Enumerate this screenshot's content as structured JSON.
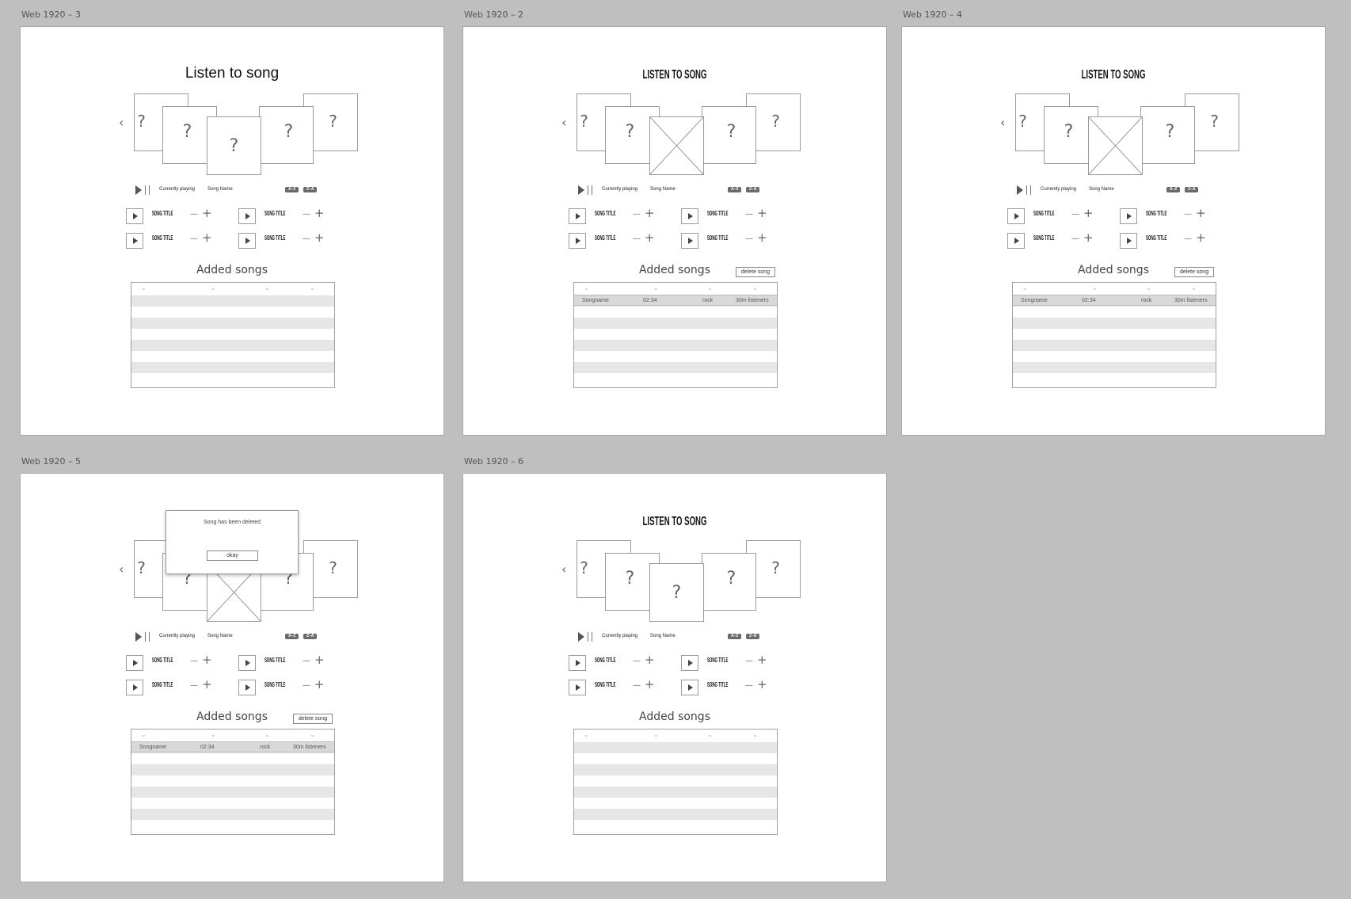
{
  "frames": [
    {
      "label": "Web 1920 – 3",
      "title": "Listen to song",
      "title_style": "regular",
      "center_card": "?",
      "prev_arrow": "‹",
      "next_arrow": "›",
      "card_marks": [
        "?",
        "?",
        "?",
        "?"
      ],
      "controls": {
        "currently_playing": "Currently playing",
        "song_name": "Song Name",
        "sort_az": "A–Z",
        "sort_za": "Z–A"
      },
      "songs": [
        "SONG TITLE",
        "SONG TITLE",
        "SONG TITLE",
        "SONG TITLE"
      ],
      "added_title": "Added songs",
      "delete_label": "",
      "row": null,
      "modal": null
    },
    {
      "label": "Web 1920 – 2",
      "title": "LISTEN TO SONG",
      "title_style": "condensed",
      "center_card": "image",
      "prev_arrow": "‹",
      "next_arrow": "›",
      "card_marks": [
        "?",
        "?",
        "?",
        "?"
      ],
      "controls": {
        "currently_playing": "Currently playing",
        "song_name": "Song Name",
        "sort_az": "A–Z",
        "sort_za": "Z–A"
      },
      "songs": [
        "SONG TITLE",
        "SONG TITLE",
        "SONG TITLE",
        "SONG TITLE"
      ],
      "added_title": "Added songs",
      "delete_label": "delete song",
      "row": {
        "name": "Songname",
        "duration": "02:34",
        "genre": "rock",
        "listeners": "30m listeners"
      },
      "modal": null
    },
    {
      "label": "Web 1920 – 4",
      "title": "LISTEN TO SONG",
      "title_style": "condensed",
      "center_card": "image",
      "prev_arrow": "‹",
      "next_arrow": "›",
      "card_marks": [
        "?",
        "?",
        "?",
        "?"
      ],
      "controls": {
        "currently_playing": "Currently playing",
        "song_name": "Song Name",
        "sort_az": "A–Z",
        "sort_za": "Z–A"
      },
      "songs": [
        "SONG TITLE",
        "SONG TITLE",
        "SONG TITLE",
        "SONG TITLE"
      ],
      "added_title": "Added songs",
      "delete_label": "delete song",
      "row": {
        "name": "Songname",
        "duration": "02:34",
        "genre": "rock",
        "listeners": "30m listeners"
      },
      "modal": null
    },
    {
      "label": "Web 1920 – 5",
      "title": "",
      "title_style": "none",
      "center_card": "image",
      "prev_arrow": "‹",
      "next_arrow": "›",
      "card_marks": [
        "?",
        "?",
        "?",
        "?"
      ],
      "controls": {
        "currently_playing": "Currently playing",
        "song_name": "Song Name",
        "sort_az": "A–Z",
        "sort_za": "Z–A"
      },
      "songs": [
        "SONG TITLE",
        "SONG TITLE",
        "SONG TITLE",
        "SONG TITLE"
      ],
      "added_title": "Added songs",
      "delete_label": "delete song",
      "row": {
        "name": "Songname",
        "duration": "02:34",
        "genre": "rock",
        "listeners": "30m listeners"
      },
      "modal": {
        "message": "Song has been deleted",
        "button": "okay"
      }
    },
    {
      "label": "Web 1920 – 6",
      "title": "LISTEN TO SONG",
      "title_style": "condensed",
      "center_card": "?",
      "prev_arrow": "‹",
      "next_arrow": "›",
      "card_marks": [
        "?",
        "?",
        "?",
        "?"
      ],
      "controls": {
        "currently_playing": "Currently playing",
        "song_name": "Song Name",
        "sort_az": "A–Z",
        "sort_za": "Z–A"
      },
      "songs": [
        "SONG TITLE",
        "SONG TITLE",
        "SONG TITLE",
        "SONG TITLE"
      ],
      "added_title": "Added songs",
      "delete_label": "",
      "row": null,
      "modal": null
    }
  ]
}
